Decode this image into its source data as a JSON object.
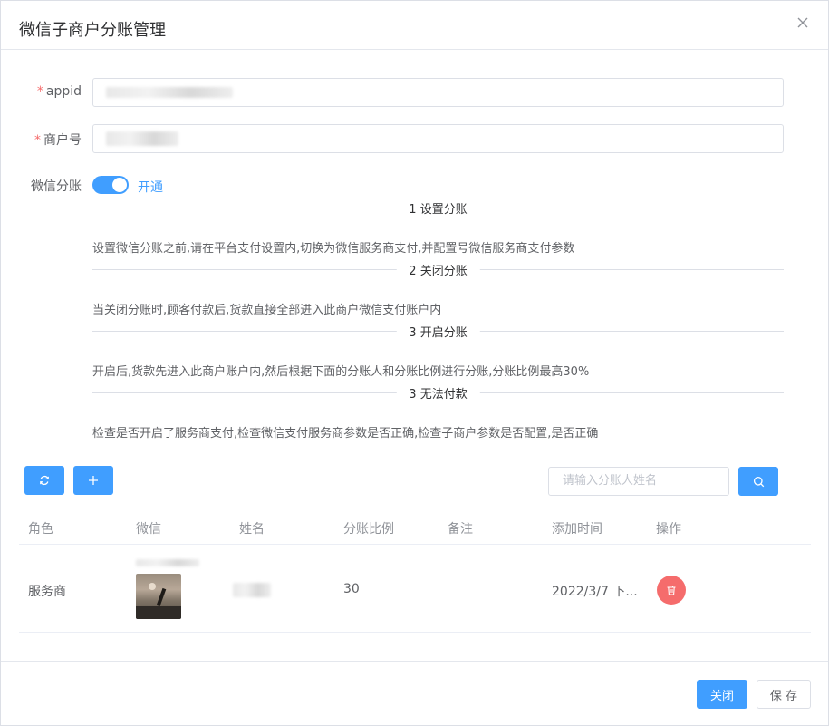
{
  "dialog": {
    "title": "微信子商户分账管理"
  },
  "form": {
    "appid_label": "appid",
    "merchant_label": "商户号",
    "split_label": "微信分账",
    "split_switch_text": "开通",
    "split_enabled": true
  },
  "steps": [
    {
      "title": "1 设置分账",
      "desc": "设置微信分账之前,请在平台支付设置内,切换为微信服务商支付,并配置号微信服务商支付参数"
    },
    {
      "title": "2 关闭分账",
      "desc": "当关闭分账时,顾客付款后,货款直接全部进入此商户微信支付账户内"
    },
    {
      "title": "3 开启分账",
      "desc": "开启后,货款先进入此商户账户内,然后根据下面的分账人和分账比例进行分账,分账比例最高30%"
    },
    {
      "title": "3 无法付款",
      "desc": "检查是否开启了服务商支付,检查微信支付服务商参数是否正确,检查子商户参数是否配置,是否正确"
    }
  ],
  "toolbar": {
    "search_placeholder": "请输入分账人姓名"
  },
  "table": {
    "columns": [
      "角色",
      "微信",
      "姓名",
      "分账比例",
      "备注",
      "添加时间",
      "操作"
    ],
    "rows": [
      {
        "role": "服务商",
        "ratio": "30",
        "remark": "",
        "time": "2022/3/7 下..."
      }
    ]
  },
  "footer": {
    "close_label": "关闭",
    "save_label": "保 存"
  },
  "colors": {
    "primary": "#409eff",
    "danger": "#f56c6c"
  }
}
